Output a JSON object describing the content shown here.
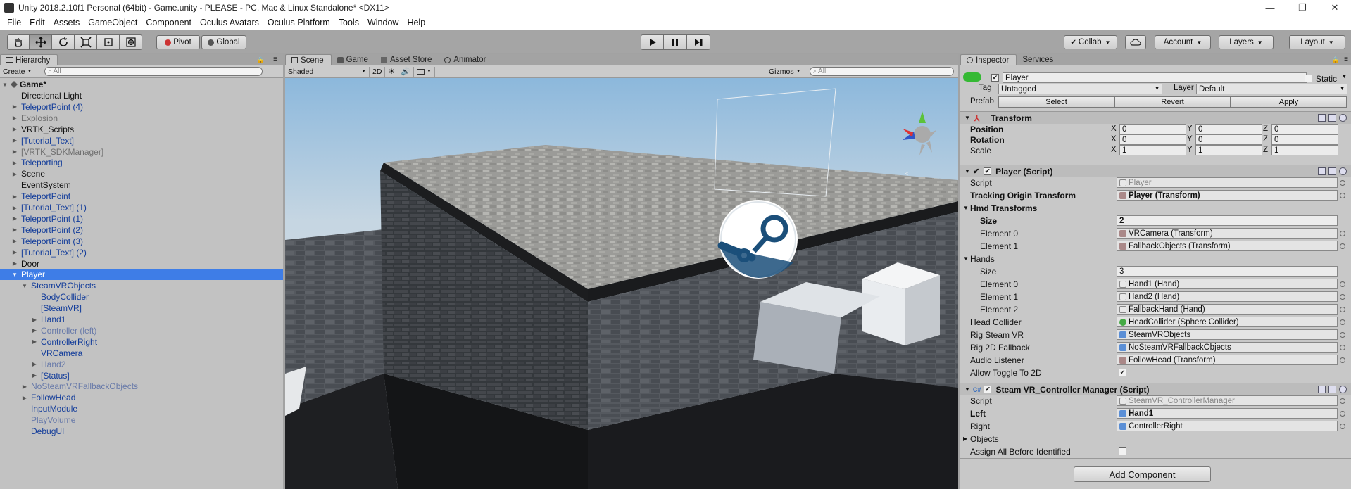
{
  "window": {
    "title": "Unity 2018.2.10f1 Personal (64bit) - Game.unity - PLEASE - PC, Mac & Linux Standalone* <DX11>",
    "minimize": "—",
    "maximize": "❐",
    "close": "✕"
  },
  "menu": [
    "File",
    "Edit",
    "Assets",
    "GameObject",
    "Component",
    "Oculus Avatars",
    "Oculus Platform",
    "Tools",
    "Window",
    "Help"
  ],
  "toolbar": {
    "pivot": "Pivot",
    "global": "Global",
    "collab": "Collab",
    "account": "Account",
    "layers": "Layers",
    "layout": "Layout"
  },
  "hierarchy": {
    "tab": "Hierarchy",
    "create": "Create",
    "search_placeholder": "All",
    "scene_name": "Game*",
    "items": [
      {
        "label": "Directional Light",
        "depth": 1,
        "arrow": "",
        "style": ""
      },
      {
        "label": "TeleportPoint (4)",
        "depth": 1,
        "arrow": "right",
        "style": "prefab"
      },
      {
        "label": "Explosion",
        "depth": 1,
        "arrow": "right",
        "style": "inactive"
      },
      {
        "label": "VRTK_Scripts",
        "depth": 1,
        "arrow": "right",
        "style": ""
      },
      {
        "label": "[Tutorial_Text]",
        "depth": 1,
        "arrow": "right",
        "style": "prefab"
      },
      {
        "label": "[VRTK_SDKManager]",
        "depth": 1,
        "arrow": "right",
        "style": "inactive"
      },
      {
        "label": "Teleporting",
        "depth": 1,
        "arrow": "right",
        "style": "prefab"
      },
      {
        "label": "Scene",
        "depth": 1,
        "arrow": "right",
        "style": ""
      },
      {
        "label": "EventSystem",
        "depth": 1,
        "arrow": "",
        "style": ""
      },
      {
        "label": "TeleportPoint",
        "depth": 1,
        "arrow": "right",
        "style": "prefab"
      },
      {
        "label": "[Tutorial_Text] (1)",
        "depth": 1,
        "arrow": "right",
        "style": "prefab"
      },
      {
        "label": "TeleportPoint (1)",
        "depth": 1,
        "arrow": "right",
        "style": "prefab"
      },
      {
        "label": "TeleportPoint (2)",
        "depth": 1,
        "arrow": "right",
        "style": "prefab"
      },
      {
        "label": "TeleportPoint (3)",
        "depth": 1,
        "arrow": "right",
        "style": "prefab"
      },
      {
        "label": "[Tutorial_Text] (2)",
        "depth": 1,
        "arrow": "right",
        "style": "prefab"
      },
      {
        "label": "Door",
        "depth": 1,
        "arrow": "right",
        "style": ""
      },
      {
        "label": "Player",
        "depth": 1,
        "arrow": "down",
        "style": "selected"
      },
      {
        "label": "SteamVRObjects",
        "depth": 2,
        "arrow": "down",
        "style": "prefab"
      },
      {
        "label": "BodyCollider",
        "depth": 3,
        "arrow": "",
        "style": "prefab"
      },
      {
        "label": "[SteamVR]",
        "depth": 3,
        "arrow": "",
        "style": "prefab"
      },
      {
        "label": "Hand1",
        "depth": 3,
        "arrow": "right",
        "style": "prefab"
      },
      {
        "label": "Controller (left)",
        "depth": 3,
        "arrow": "right",
        "style": "prefab inactive"
      },
      {
        "label": "ControllerRight",
        "depth": 3,
        "arrow": "right",
        "style": "prefab"
      },
      {
        "label": "VRCamera",
        "depth": 3,
        "arrow": "",
        "style": "prefab"
      },
      {
        "label": "Hand2",
        "depth": 3,
        "arrow": "right",
        "style": "prefab inactive"
      },
      {
        "label": "[Status]",
        "depth": 3,
        "arrow": "right",
        "style": "prefab"
      },
      {
        "label": "NoSteamVRFallbackObjects",
        "depth": 2,
        "arrow": "right",
        "style": "prefab inactive"
      },
      {
        "label": "FollowHead",
        "depth": 2,
        "arrow": "right",
        "style": "prefab"
      },
      {
        "label": "InputModule",
        "depth": 2,
        "arrow": "",
        "style": "prefab"
      },
      {
        "label": "PlayVolume",
        "depth": 2,
        "arrow": "",
        "style": "prefab inactive"
      },
      {
        "label": "DebugUI",
        "depth": 2,
        "arrow": "",
        "style": "prefab"
      }
    ]
  },
  "scene": {
    "tabs": [
      "Scene",
      "Game",
      "Asset Store",
      "Animator"
    ],
    "shading": "Shaded",
    "mode_2d": "2D",
    "gizmos": "Gizmos",
    "search_placeholder": "All"
  },
  "inspector": {
    "tabs": [
      "Inspector",
      "Services"
    ],
    "object_name": "Player",
    "static": "Static",
    "tag_label": "Tag",
    "tag_value": "Untagged",
    "layer_label": "Layer",
    "layer_value": "Default",
    "prefab_label": "Prefab",
    "prefab_select": "Select",
    "prefab_revert": "Revert",
    "prefab_apply": "Apply",
    "transform": {
      "title": "Transform",
      "position_label": "Position",
      "rotation_label": "Rotation",
      "scale_label": "Scale",
      "x": "X",
      "y": "Y",
      "z": "Z",
      "position": [
        "0",
        "0",
        "0"
      ],
      "rotation": [
        "0",
        "0",
        "0"
      ],
      "scale": [
        "1",
        "1",
        "1"
      ]
    },
    "player_script": {
      "title": "Player (Script)",
      "script_label": "Script",
      "script_value": "Player",
      "tracking_label": "Tracking Origin Transform",
      "tracking_value": "Player (Transform)",
      "hmd_label": "Hmd Transforms",
      "hmd_size_label": "Size",
      "hmd_size": "2",
      "hmd_e0_label": "Element 0",
      "hmd_e0": "VRCamera (Transform)",
      "hmd_e1_label": "Element 1",
      "hmd_e1": "FallbackObjects (Transform)",
      "hands_label": "Hands",
      "hands_size_label": "Size",
      "hands_size": "3",
      "hands_e0_label": "Element 0",
      "hands_e0": "Hand1 (Hand)",
      "hands_e1_label": "Element 1",
      "hands_e1": "Hand2 (Hand)",
      "hands_e2_label": "Element 2",
      "hands_e2": "FallbackHand (Hand)",
      "head_collider_label": "Head Collider",
      "head_collider": "HeadCollider (Sphere Collider)",
      "rig_steam_label": "Rig Steam VR",
      "rig_steam": "SteamVRObjects",
      "rig_2d_label": "Rig 2D Fallback",
      "rig_2d": "NoSteamVRFallbackObjects",
      "audio_label": "Audio Listener",
      "audio": "FollowHead (Transform)",
      "toggle_label": "Allow Toggle To 2D"
    },
    "controller_manager": {
      "title": "Steam VR_Controller Manager (Script)",
      "script_label": "Script",
      "script_value": "SteamVR_ControllerManager",
      "left_label": "Left",
      "left": "Hand1",
      "right_label": "Right",
      "right": "ControllerRight",
      "objects_label": "Objects",
      "assign_label": "Assign All Before Identified"
    },
    "add_component": "Add Component"
  },
  "colors": {
    "selection": "#3e7de7",
    "prefab_text": "#123c9a",
    "panel_bg": "#c2c2c2",
    "steam_blue": "#1b4f7a"
  }
}
